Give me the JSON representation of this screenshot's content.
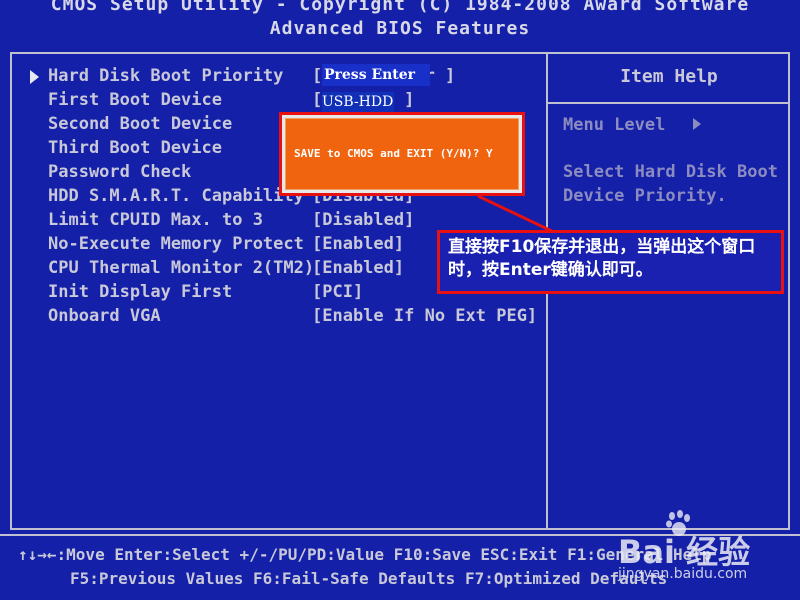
{
  "header": {
    "line1": "CMOS Setup Utility - Copyright (C) 1984-2008 Award Software",
    "line2": "Advanced BIOS Features"
  },
  "settings": [
    {
      "name": "Hard Disk Boot Priority",
      "value": "[Press Enter ]"
    },
    {
      "name": "First Boot Device",
      "value": "[USB-HDD ]"
    },
    {
      "name": "Second Boot Device",
      "value": ""
    },
    {
      "name": "Third Boot Device",
      "value": ""
    },
    {
      "name": "Password Check",
      "value": ""
    },
    {
      "name": "HDD S.M.A.R.T. Capability",
      "value": "[Disabled]"
    },
    {
      "name": "Limit CPUID Max. to 3",
      "value": "[Disabled]"
    },
    {
      "name": "No-Execute Memory Protect",
      "value": "[Enabled]"
    },
    {
      "name": "CPU Thermal Monitor 2(TM2)",
      "value": "[Enabled]"
    },
    {
      "name": "Init Display First",
      "value": "[PCI]"
    },
    {
      "name": "Onboard VGA",
      "value": "[Enable If No Ext PEG]"
    }
  ],
  "highlight": {
    "press_enter": "Press Enter",
    "usb_hdd": "USB-HDD"
  },
  "help": {
    "title": "Item Help",
    "menu_level": "Menu Level",
    "desc_line1": "Select Hard Disk Boot",
    "desc_line2": "Device Priority."
  },
  "dialog": {
    "message": "SAVE to CMOS and EXIT (Y/N)? Y"
  },
  "annotation": {
    "text": "直接按F10保存并退出，当弹出这个窗口时，按Enter键确认即可。"
  },
  "footer": {
    "line1": "↑↓→←:Move   Enter:Select   +/-/PU/PD:Value   F10:Save   ESC:Exit   F1:General Help",
    "line2": "F5:Previous Values   F6:Fail-Safe Defaults   F7:Optimized Defaults"
  },
  "watermark": {
    "logo": "Bai  经验",
    "url": "jingyan.baidu.com"
  },
  "colors": {
    "background": "#1420a8",
    "dialog": "#f06410",
    "annotation_border": "#e81010"
  }
}
